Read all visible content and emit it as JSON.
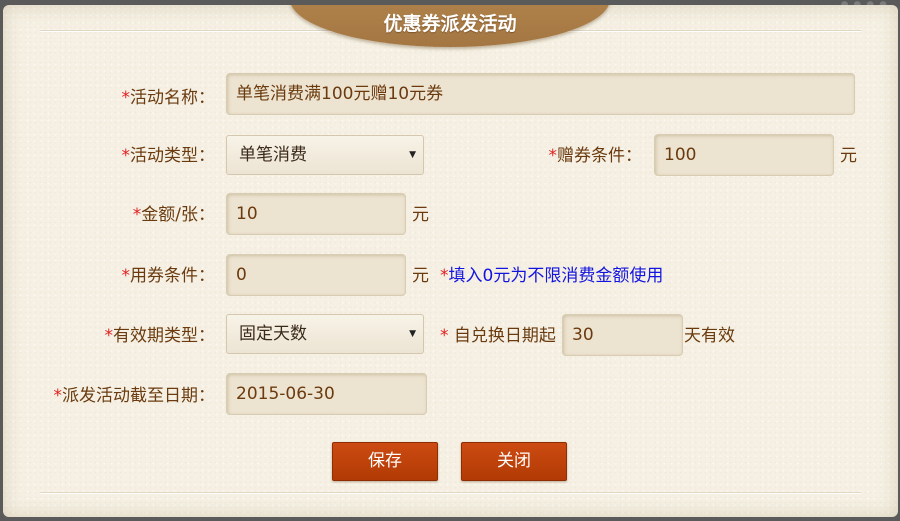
{
  "dialog": {
    "title": "优惠券派发活动",
    "save_label": "保存",
    "close_label": "关闭"
  },
  "form": {
    "required_mark": "*",
    "activity_name": {
      "label": "活动名称：",
      "value": "单笔消费满100元赠10元券"
    },
    "activity_type": {
      "label": "活动类型：",
      "value": "单笔消费"
    },
    "gift_condition": {
      "label": "赠券条件：",
      "value": "100",
      "unit": "元"
    },
    "amount_per_coupon": {
      "label": "金额/张：",
      "value": "10",
      "unit": "元"
    },
    "use_condition": {
      "label": "用券条件：",
      "value": "0",
      "unit": "元",
      "hint": "填入0元为不限消费金额使用"
    },
    "validity_type": {
      "label": "有效期类型：",
      "value": "固定天数"
    },
    "validity_days": {
      "prefix": " 自兑换日期起",
      "value": "30",
      "suffix": "天有效"
    },
    "end_date": {
      "label": "派发活动截至日期：",
      "value": "2015-06-30"
    }
  }
}
